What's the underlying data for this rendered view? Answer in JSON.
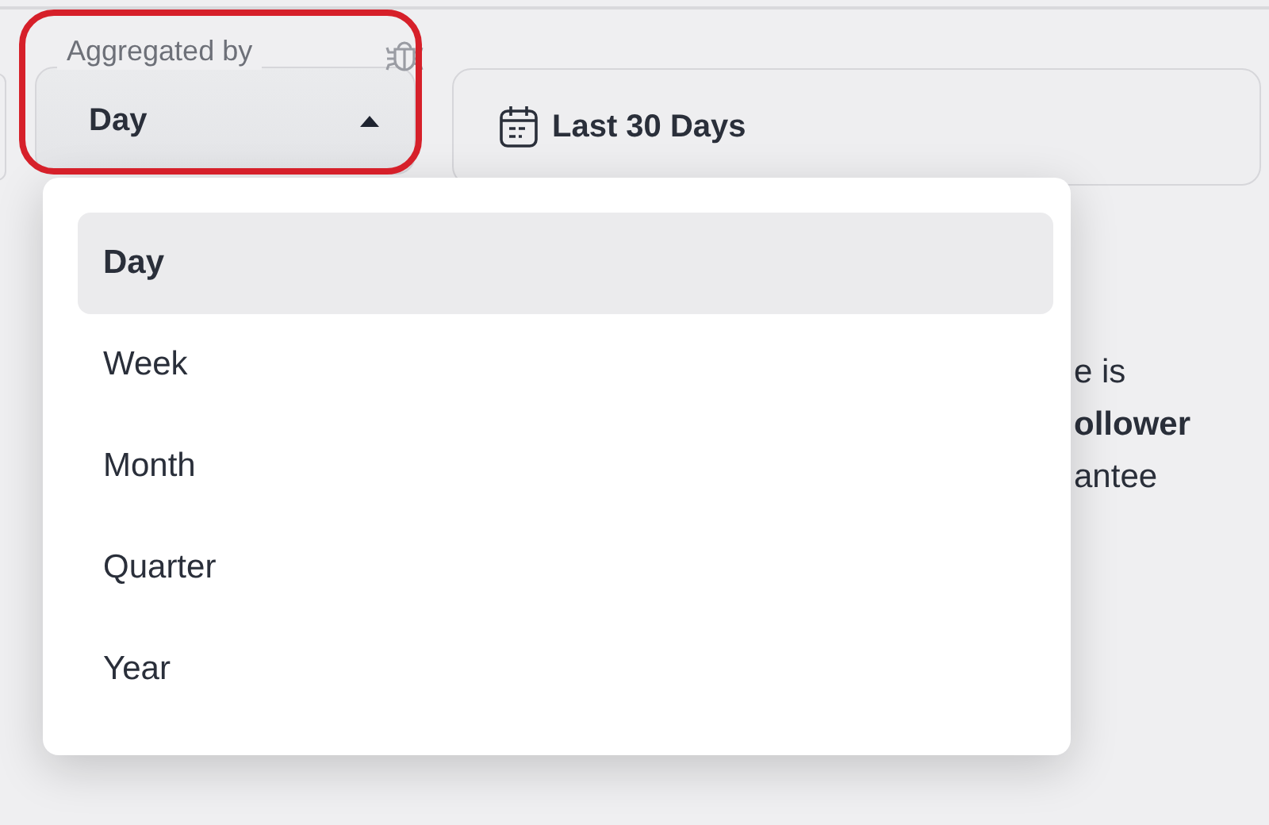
{
  "filter": {
    "label": "Aggregated by",
    "value": "Day",
    "expanded": true
  },
  "date_range": {
    "label": "Last 30 Days"
  },
  "dropdown": {
    "options": [
      {
        "label": "Day",
        "selected": true
      },
      {
        "label": "Week",
        "selected": false
      },
      {
        "label": "Month",
        "selected": false
      },
      {
        "label": "Quarter",
        "selected": false
      },
      {
        "label": "Year",
        "selected": false
      }
    ]
  },
  "background_text": [
    {
      "text": "e is",
      "bold": false
    },
    {
      "text": "ollower",
      "bold": true
    },
    {
      "text": "antee",
      "bold": false
    }
  ]
}
